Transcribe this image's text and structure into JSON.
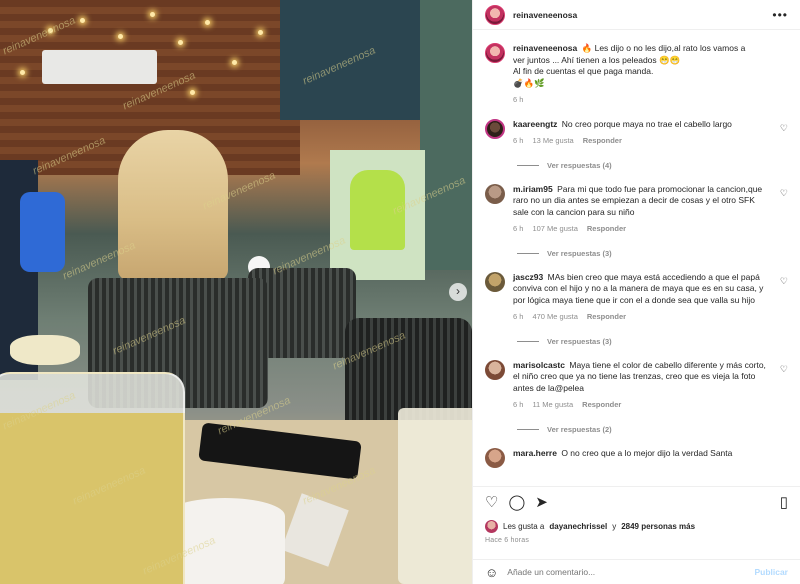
{
  "photo": {
    "watermark": "reinaveneenosa",
    "next_icon": "›"
  },
  "post": {
    "username": "reinaveneenosa",
    "more_icon": "•••",
    "caption_username": "reinaveneenosa",
    "caption_lines": [
      "🔥 Les dijo o no les dijo,al rato los vamos a",
      "ver juntos ... Ahí tienen a los peleados 😁😁",
      "Al fin de cuentas el que paga manda.",
      "💣🔥🌿"
    ],
    "caption_time": "6 h"
  },
  "comments": [
    {
      "username": "kaareengtz",
      "text": "No creo porque maya no trae el cabello largo",
      "time": "6 h",
      "likes": "13 Me gusta",
      "reply": "Responder",
      "view_replies": "Ver respuestas (4)"
    },
    {
      "username": "m.iriam95",
      "text": "Para mi que todo fue para promocionar la cancion,que raro no un dia antes se empiezan a decir de cosas y el otro SFK sale con la cancion para su niño",
      "time": "6 h",
      "likes": "107 Me gusta",
      "reply": "Responder",
      "view_replies": "Ver respuestas (3)"
    },
    {
      "username": "jascz93",
      "text": "MAs bien creo que maya está accediendo a que el papá conviva con el hijo y no a la manera de maya que es en su casa, y por lógica maya tiene que ir con el a donde sea que valla su hijo",
      "time": "6 h",
      "likes": "470 Me gusta",
      "reply": "Responder",
      "view_replies": "Ver respuestas (3)"
    },
    {
      "username": "marisolcastc",
      "text": "Maya tiene el color de cabello diferente y más corto, el niño creo que ya no tiene las trenzas, creo que es vieja la foto antes de la@pelea",
      "time": "6 h",
      "likes": "11 Me gusta",
      "reply": "Responder",
      "view_replies": "Ver respuestas (2)"
    },
    {
      "username": "mara.herre",
      "text": "O no creo que a lo mejor dijo la verdad Santa"
    }
  ],
  "actions": {
    "like_icon": "♡",
    "comment_icon": "◯",
    "share_icon": "➤",
    "bookmark_icon": "▯"
  },
  "likes": {
    "prefix": "Les gusta a",
    "user": "dayanechrissel",
    "middle": "y",
    "count": "2849 personas más"
  },
  "time_ago": "Hace 6 horas",
  "add_comment": {
    "emoji_icon": "☺",
    "placeholder": "Añade un comentario...",
    "publish": "Publicar"
  },
  "colors": {
    "link_blue": "#b3dbff",
    "muted": "#8e8e8e",
    "text": "#262626"
  }
}
